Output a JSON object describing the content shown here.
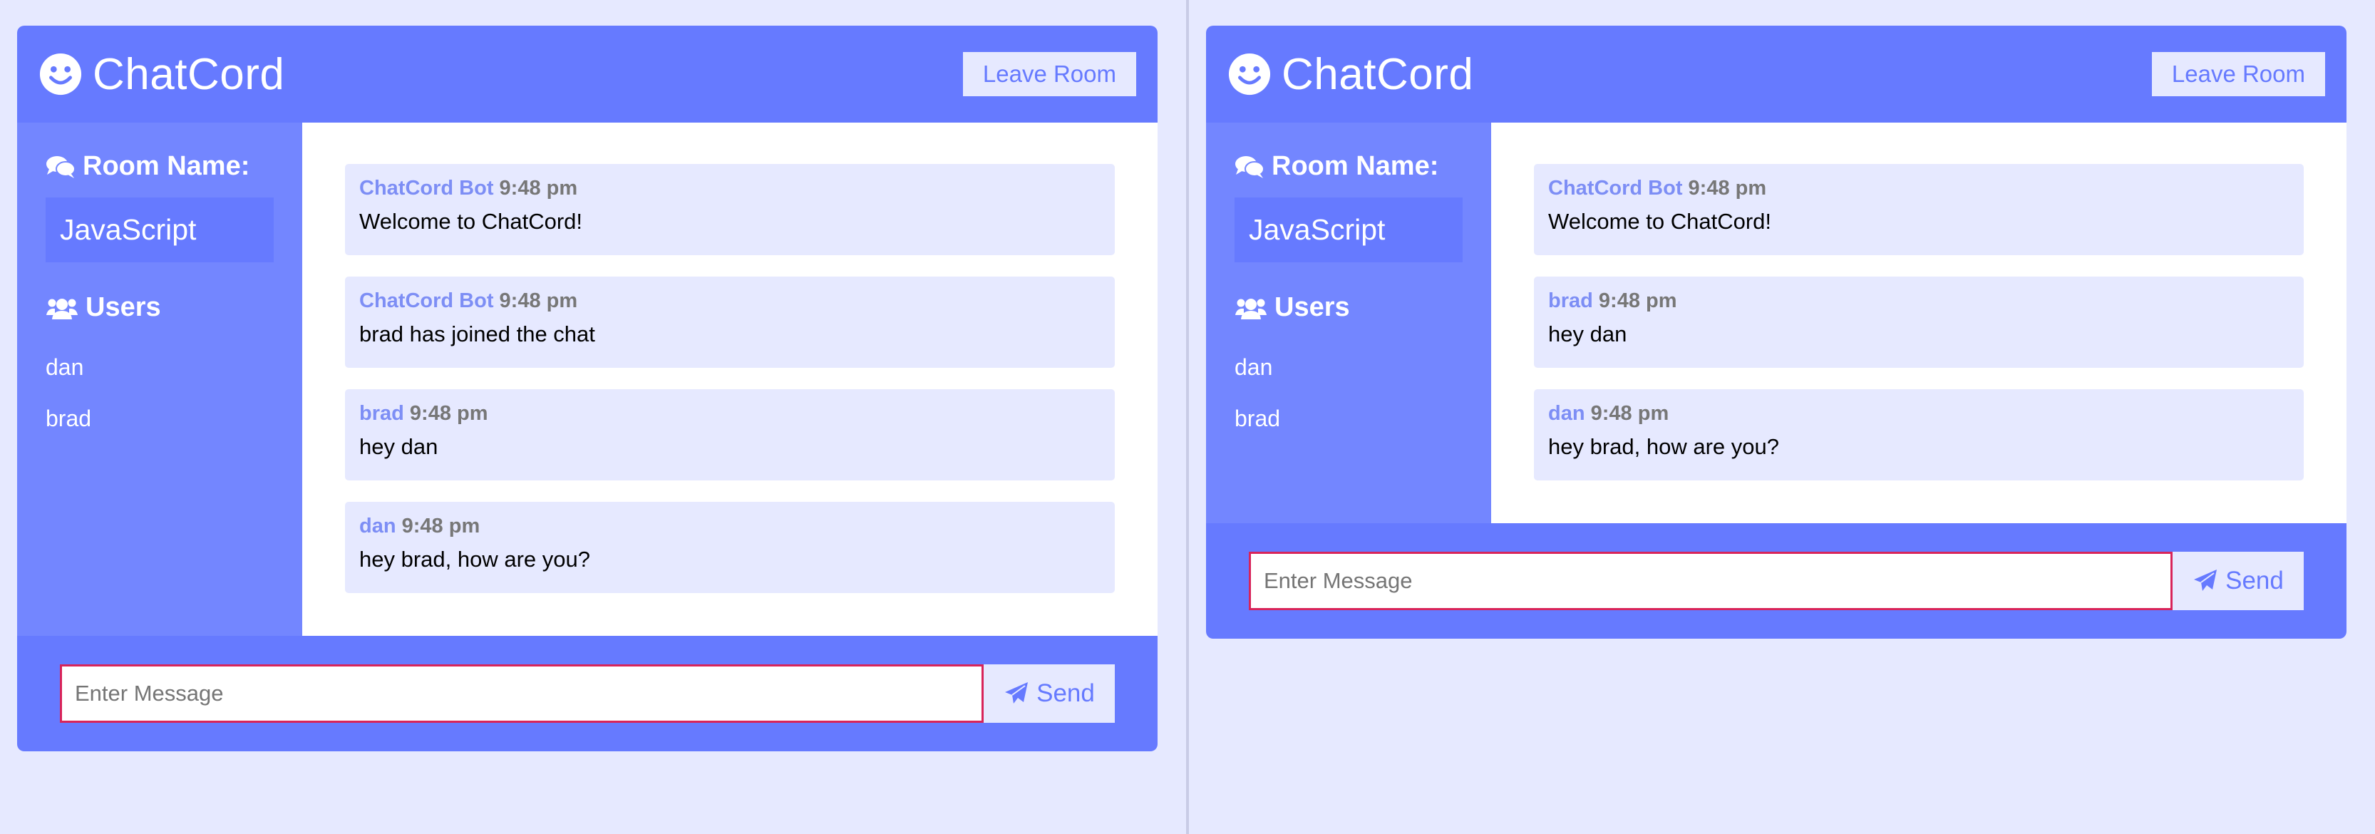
{
  "app": {
    "brand": "ChatCord",
    "leave_label": "Leave Room",
    "room_heading": "Room Name:",
    "users_heading": "Users",
    "send_label": "Send",
    "message_placeholder": "Enter Message"
  },
  "colors": {
    "primary": "#667aff",
    "sidebar": "#7386ff",
    "light": "#e6e9ff",
    "input_border": "#d8245a"
  },
  "icons": {
    "brand": "smile-icon",
    "room": "comments-icon",
    "users": "users-icon",
    "send": "paper-plane-icon"
  },
  "windows": [
    {
      "room_name": "JavaScript",
      "users": [
        "dan",
        "brad"
      ],
      "messages": [
        {
          "user": "ChatCord Bot",
          "time": "9:48 pm",
          "text": "Welcome to ChatCord!"
        },
        {
          "user": "ChatCord Bot",
          "time": "9:48 pm",
          "text": "brad has joined the chat"
        },
        {
          "user": "brad",
          "time": "9:48 pm",
          "text": "hey dan"
        },
        {
          "user": "dan",
          "time": "9:48 pm",
          "text": "hey brad, how are you?"
        }
      ]
    },
    {
      "room_name": "JavaScript",
      "users": [
        "dan",
        "brad"
      ],
      "messages": [
        {
          "user": "ChatCord Bot",
          "time": "9:48 pm",
          "text": "Welcome to ChatCord!"
        },
        {
          "user": "brad",
          "time": "9:48 pm",
          "text": "hey dan"
        },
        {
          "user": "dan",
          "time": "9:48 pm",
          "text": "hey brad, how are you?"
        }
      ]
    }
  ]
}
